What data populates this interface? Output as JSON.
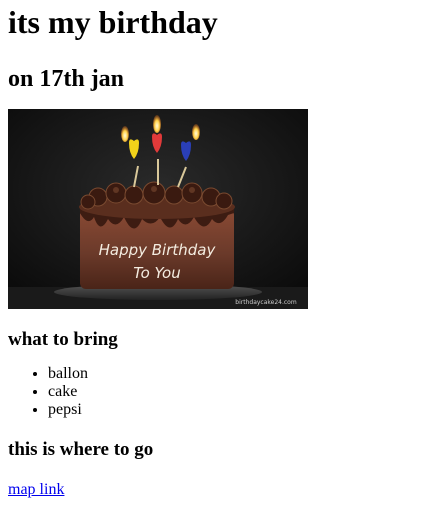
{
  "page": {
    "title": "its my birthday",
    "subtitle": "on 17th jan"
  },
  "image": {
    "alt": "chocolate birthday cake with three candles",
    "text_line1": "Happy Birthday",
    "text_line2": "To You",
    "watermark": "birthdaycake24.com",
    "candle_colors": [
      "#f2d21a",
      "#e23a3a",
      "#2a3fb8"
    ],
    "background_color": "#121212",
    "cake_color": "#6b3a2a"
  },
  "bring": {
    "heading": "what to bring",
    "items": [
      "ballon",
      "cake",
      "pepsi"
    ]
  },
  "where": {
    "heading": "this is where to go",
    "link_label": "map link"
  }
}
